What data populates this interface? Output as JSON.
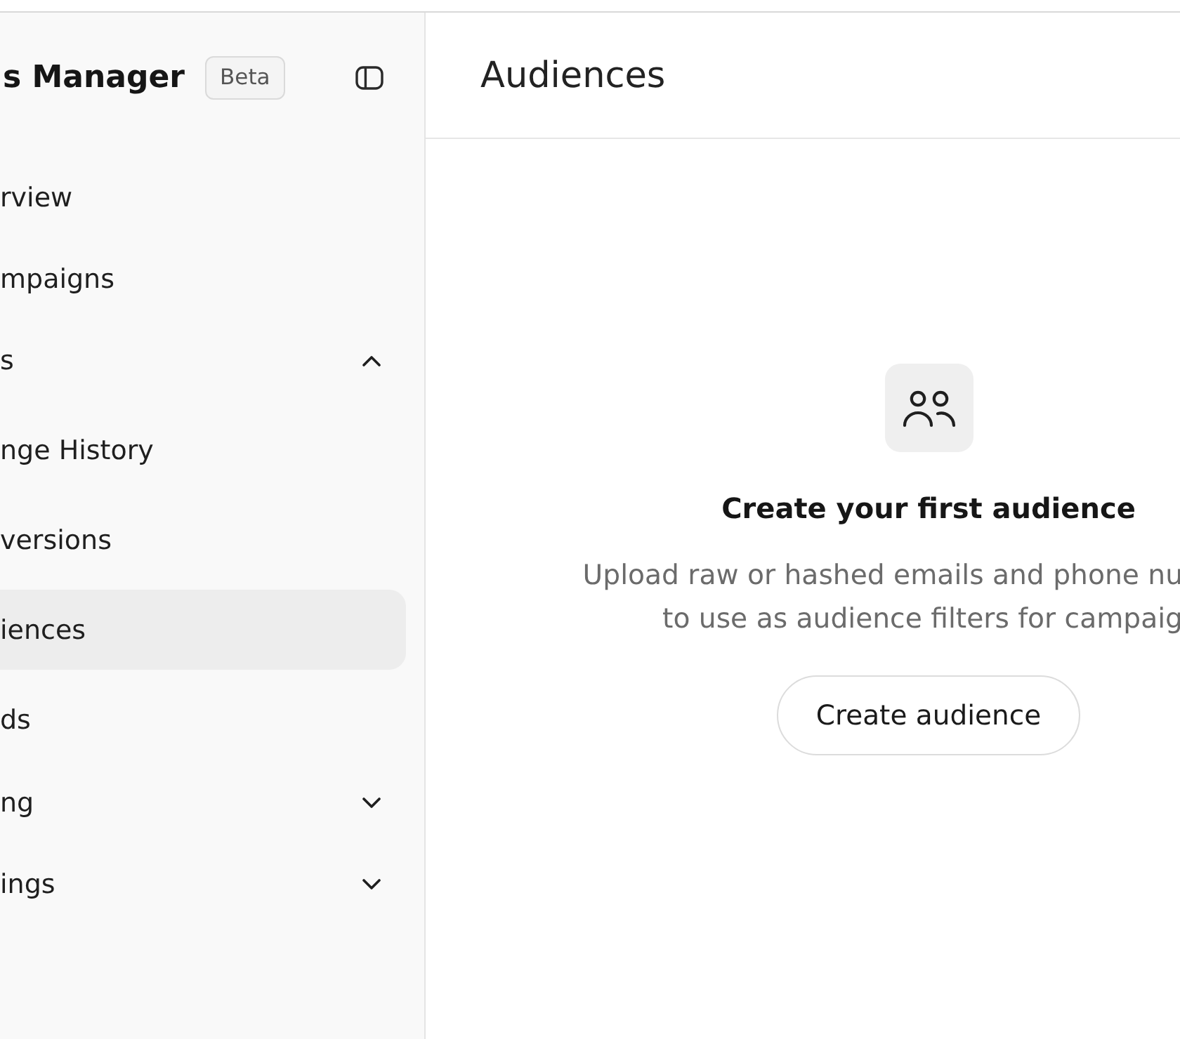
{
  "sidebar": {
    "title": "s Manager",
    "badge": "Beta",
    "items": [
      {
        "label": "rview",
        "selected": false
      },
      {
        "label": "mpaigns",
        "selected": false
      },
      {
        "label": "s",
        "selected": false,
        "expanded": true,
        "children": [
          {
            "label": "nge History",
            "selected": false
          },
          {
            "label": "versions",
            "selected": false
          },
          {
            "label": "iences",
            "selected": true
          },
          {
            "label": "ds",
            "selected": false
          }
        ]
      },
      {
        "label": "ng",
        "selected": false,
        "expanded": false
      },
      {
        "label": "ings",
        "selected": false,
        "expanded": false
      }
    ]
  },
  "page": {
    "title": "Audiences"
  },
  "empty_state": {
    "heading": "Create your first audience",
    "description_lines": [
      "Upload raw or hashed emails and phone nu",
      "to use as audience filters for campaig"
    ],
    "button": "Create audience"
  }
}
